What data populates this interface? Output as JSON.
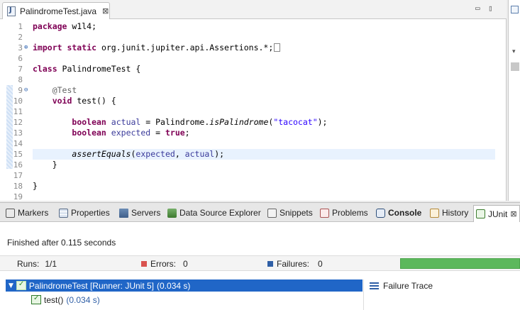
{
  "editor": {
    "tab": {
      "title": "PalindromeTest.java",
      "close_glyph": "⊠"
    },
    "controls": {
      "minimize": "▭",
      "maximize": "▯"
    },
    "lines": [
      {
        "num": "1",
        "parts": [
          [
            "kw",
            "package"
          ],
          [
            "t",
            " w1l4;"
          ]
        ]
      },
      {
        "num": "2",
        "parts": []
      },
      {
        "num": "3",
        "mark": "⊕",
        "parts": [
          [
            "kw",
            "import static"
          ],
          [
            "t",
            " org.junit.jupiter.api.Assertions.*;"
          ]
        ],
        "box": true
      },
      {
        "num": "6",
        "parts": []
      },
      {
        "num": "7",
        "parts": [
          [
            "kw",
            "class"
          ],
          [
            "t",
            " PalindromeTest {"
          ]
        ]
      },
      {
        "num": "8",
        "parts": []
      },
      {
        "num": "9",
        "mark": "⊖",
        "parts": [
          [
            "t",
            "    "
          ],
          [
            "ann",
            "@Test"
          ]
        ]
      },
      {
        "num": "10",
        "parts": [
          [
            "t",
            "    "
          ],
          [
            "kw",
            "void"
          ],
          [
            "t",
            " test() {"
          ]
        ]
      },
      {
        "num": "11",
        "parts": []
      },
      {
        "num": "12",
        "parts": [
          [
            "t",
            "        "
          ],
          [
            "kw",
            "boolean"
          ],
          [
            "t",
            " "
          ],
          [
            "var",
            "actual"
          ],
          [
            "t",
            " = Palindrome."
          ],
          [
            "ital",
            "isPalindrome"
          ],
          [
            "t",
            "("
          ],
          [
            "str",
            "\"tacocat\""
          ],
          [
            "t",
            ");"
          ]
        ]
      },
      {
        "num": "13",
        "parts": [
          [
            "t",
            "        "
          ],
          [
            "kw",
            "boolean"
          ],
          [
            "t",
            " "
          ],
          [
            "var",
            "expected"
          ],
          [
            "t",
            " = "
          ],
          [
            "kw",
            "true"
          ],
          [
            "t",
            ";"
          ]
        ]
      },
      {
        "num": "14",
        "parts": []
      },
      {
        "num": "15",
        "current": true,
        "parts": [
          [
            "t",
            "        "
          ],
          [
            "ital",
            "assertEquals"
          ],
          [
            "t",
            "("
          ],
          [
            "var",
            "expected"
          ],
          [
            "t",
            ", "
          ],
          [
            "var",
            "actual"
          ],
          [
            "t",
            ");"
          ]
        ]
      },
      {
        "num": "16",
        "parts": [
          [
            "t",
            "    }"
          ]
        ]
      },
      {
        "num": "17",
        "parts": []
      },
      {
        "num": "18",
        "parts": [
          [
            "t",
            "}"
          ]
        ]
      },
      {
        "num": "19",
        "parts": []
      }
    ]
  },
  "outline": {
    "chevron": "▾"
  },
  "views": {
    "tabs": [
      {
        "id": "markers",
        "label": "Markers",
        "icon": "markers-icon"
      },
      {
        "id": "properties",
        "label": "Properties",
        "icon": "properties-icon"
      },
      {
        "id": "servers",
        "label": "Servers",
        "icon": "servers-icon"
      },
      {
        "id": "dse",
        "label": "Data Source Explorer",
        "icon": "database-icon"
      },
      {
        "id": "snippets",
        "label": "Snippets",
        "icon": "snippets-icon"
      },
      {
        "id": "problems",
        "label": "Problems",
        "icon": "problems-icon"
      },
      {
        "id": "console",
        "label": "Console",
        "icon": "console-icon"
      },
      {
        "id": "history",
        "label": "History",
        "icon": "history-icon"
      },
      {
        "id": "junit",
        "label": "JUnit",
        "icon": "junit-icon"
      }
    ],
    "junit_close_glyph": "⊠"
  },
  "junit": {
    "finished_text": "Finished after 0.115 seconds",
    "runs_label": "Runs:",
    "runs_value": "1/1",
    "errors_label": "Errors:",
    "errors_value": "0",
    "failures_label": "Failures:",
    "failures_value": "0",
    "progress_fraction": 1.0,
    "progress_color": "#5cb85c",
    "tree": {
      "root_label": "PalindromeTest [Runner: JUnit 5]",
      "root_time": "(0.034 s)",
      "child_label": "test()",
      "child_time": "(0.034 s)"
    },
    "failure_trace_label": "Failure Trace"
  }
}
